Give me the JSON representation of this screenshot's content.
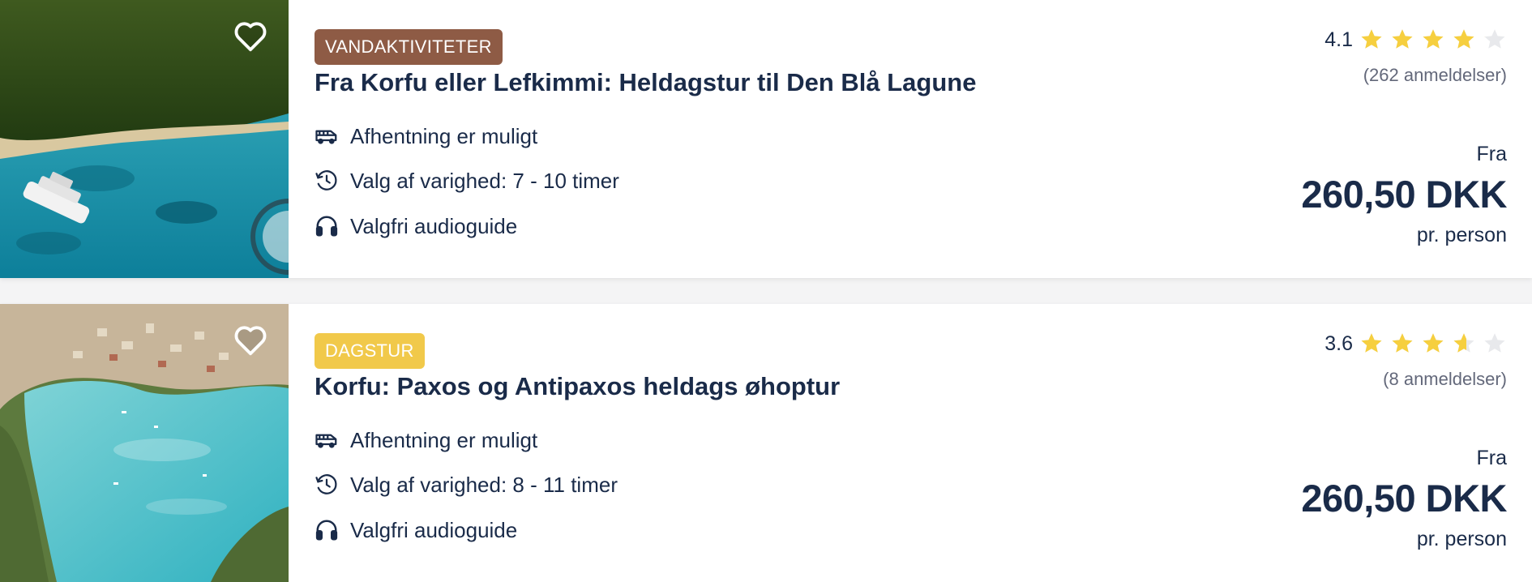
{
  "colors": {
    "badge_vandaktiviteter": "#8e5b45",
    "badge_dagstur": "#f1c94a",
    "star_filled": "#f6cf3f",
    "star_empty": "#e8e9ec",
    "text_dark": "#1a2b49",
    "text_muted": "#63687a"
  },
  "icons": {
    "pickup": "bus-icon",
    "duration": "clock-icon",
    "audio": "headphones-icon",
    "favorite": "heart-icon",
    "rating": "star-icon"
  },
  "activities": [
    {
      "badge": "VANDAKTIVITETER",
      "title": "Fra Korfu eller Lefkimmi: Heldagstur til Den Blå Lagune",
      "features": [
        "Afhentning er muligt",
        "Valg af varighed: 7 - 10 timer",
        "Valgfri audioguide"
      ],
      "rating_value": 4.1,
      "rating_text": "4.1",
      "reviews": "(262 anmeldelser)",
      "price_prefix": "Fra",
      "price": "260,50 DKK",
      "price_suffix": "pr. person"
    },
    {
      "badge": "DAGSTUR",
      "title": "Korfu: Paxos og Antipaxos heldags øhoptur",
      "features": [
        "Afhentning er muligt",
        "Valg af varighed: 8 - 11 timer",
        "Valgfri audioguide"
      ],
      "rating_value": 3.6,
      "rating_text": "3.6",
      "reviews": "(8 anmeldelser)",
      "price_prefix": "Fra",
      "price": "260,50 DKK",
      "price_suffix": "pr. person"
    }
  ]
}
